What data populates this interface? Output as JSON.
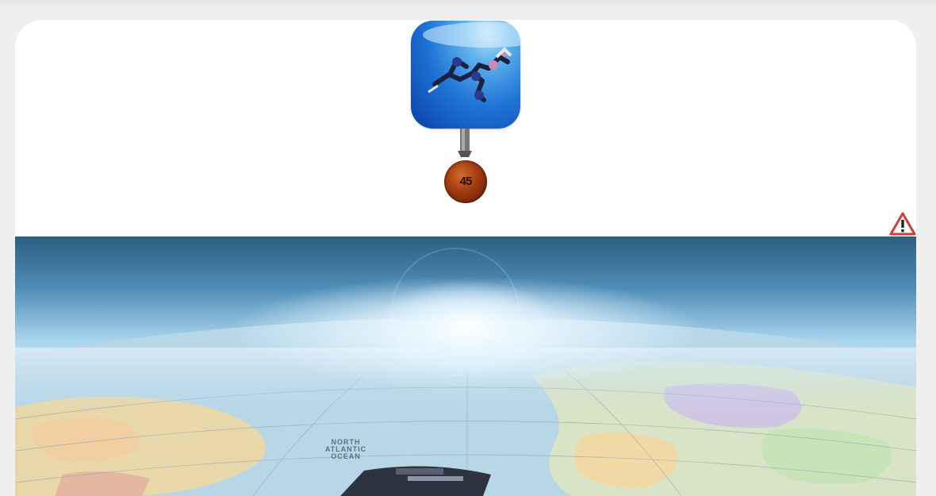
{
  "header": {
    "app_icon": "skydivers-app-icon",
    "medal": {
      "icon": "medal-icon",
      "text": "45"
    },
    "warning_icon": "warning-triangle-icon"
  },
  "hero": {
    "image": "earth-horizon-globe-map",
    "map_label_lines": [
      "NORTH",
      "ATLANTIC",
      "OCEAN"
    ]
  },
  "colors": {
    "page_bg": "#efefef",
    "card_bg": "#ffffff",
    "warning": "#d23a3a",
    "sky": "#4f8db7"
  }
}
